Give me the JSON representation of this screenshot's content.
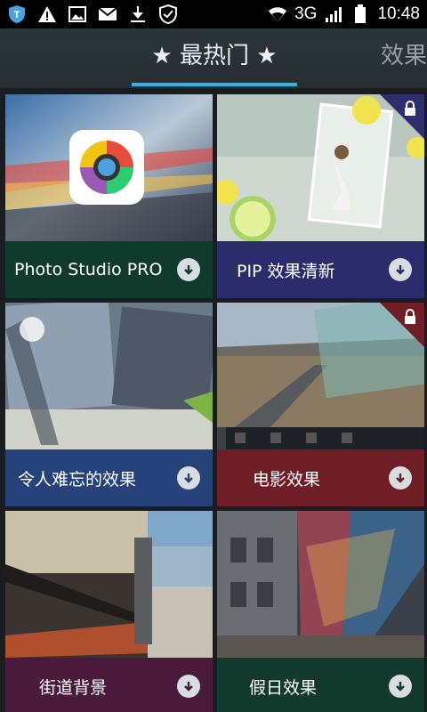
{
  "status_bar": {
    "network": "3G",
    "time": "10:48",
    "icons_left": [
      "shield-t-icon",
      "warning-icon",
      "image-icon",
      "mail-icon",
      "download-icon",
      "shield-check-icon"
    ],
    "icons_right": [
      "wifi-icon",
      "signal-icon",
      "battery-icon"
    ]
  },
  "tabs": {
    "active": "★ 最热门 ★",
    "next": "效果"
  },
  "colors": {
    "accent": "#2eb5e8",
    "card_green": "#0f3b2c",
    "card_indigo": "#2b2c6b",
    "card_blue": "#26427a",
    "card_red": "#6e1e24",
    "card_purple": "#4a1a3b",
    "card_darkgreen": "#123a2c"
  },
  "cards": [
    {
      "label": "Photo Studio PRO",
      "locked": false
    },
    {
      "label": "PIP 效果清新",
      "locked": true
    },
    {
      "label": "令人难忘的效果",
      "locked": false
    },
    {
      "label": "电影效果",
      "locked": true
    },
    {
      "label": "街道背景",
      "locked": false
    },
    {
      "label": "假日效果",
      "locked": false
    }
  ]
}
